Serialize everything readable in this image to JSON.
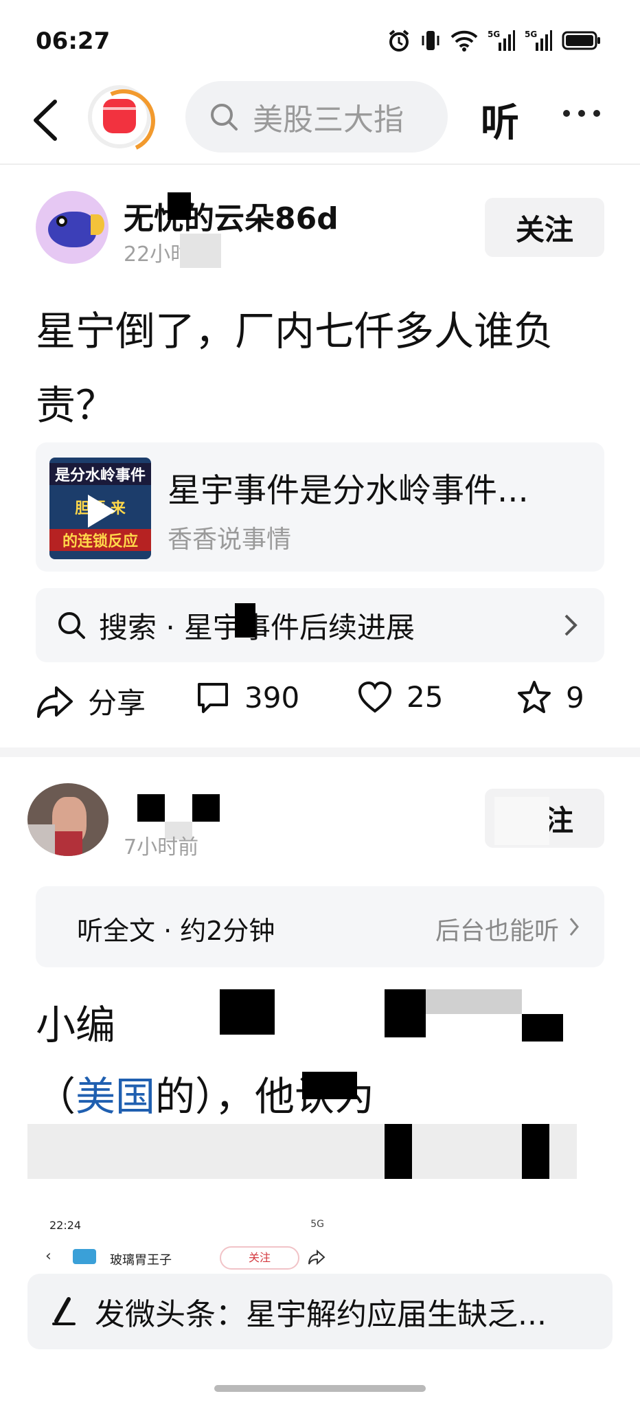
{
  "status_bar": {
    "time": "06:27",
    "icons": [
      "alarm-icon",
      "vibrate-icon",
      "wifi-icon",
      "signal-5g-icon",
      "signal-5g-icon",
      "battery-icon"
    ],
    "sim1_label": "5G",
    "sim2_label": "5G"
  },
  "nav": {
    "search_placeholder": "美股三大指",
    "listen_label": "听"
  },
  "post1": {
    "username": "无忧的云朵86d",
    "time": "22小时前",
    "follow_label": "关注",
    "headline": "星宁倒了，厂内七仟多人谁负责？",
    "video": {
      "title": "星宇事件是分水岭事件...",
      "source": "香香说事情",
      "thumb_line1": "是分水岭事件",
      "thumb_line2": "胆预  来",
      "thumb_line3": "的连锁反应"
    },
    "search_suggestion": "搜索 · 星宇事件后续进展",
    "actions": {
      "share_label": "分享",
      "comments": "390",
      "likes": "25",
      "favorites": "9"
    }
  },
  "post2": {
    "time": "7小时前",
    "follow_label": "关注",
    "listen_full": "听全文 · 约2分钟",
    "background_listen": "后台也能听",
    "body_line1": "小编",
    "body_line2_prefix": "（",
    "body_link": "美国",
    "body_line2_mid": "的",
    "body_line2_suffix": "），他认为",
    "embed": {
      "time": "22:24",
      "status": "5G",
      "name": "玻璃胃王子",
      "follow": "关注"
    }
  },
  "compose": {
    "text": "发微头条：星宇解约应届生缺乏..."
  },
  "colors": {
    "accent_red": "#f2323f",
    "link_blue": "#1f5fb0",
    "card_bg": "#f5f6f8"
  }
}
